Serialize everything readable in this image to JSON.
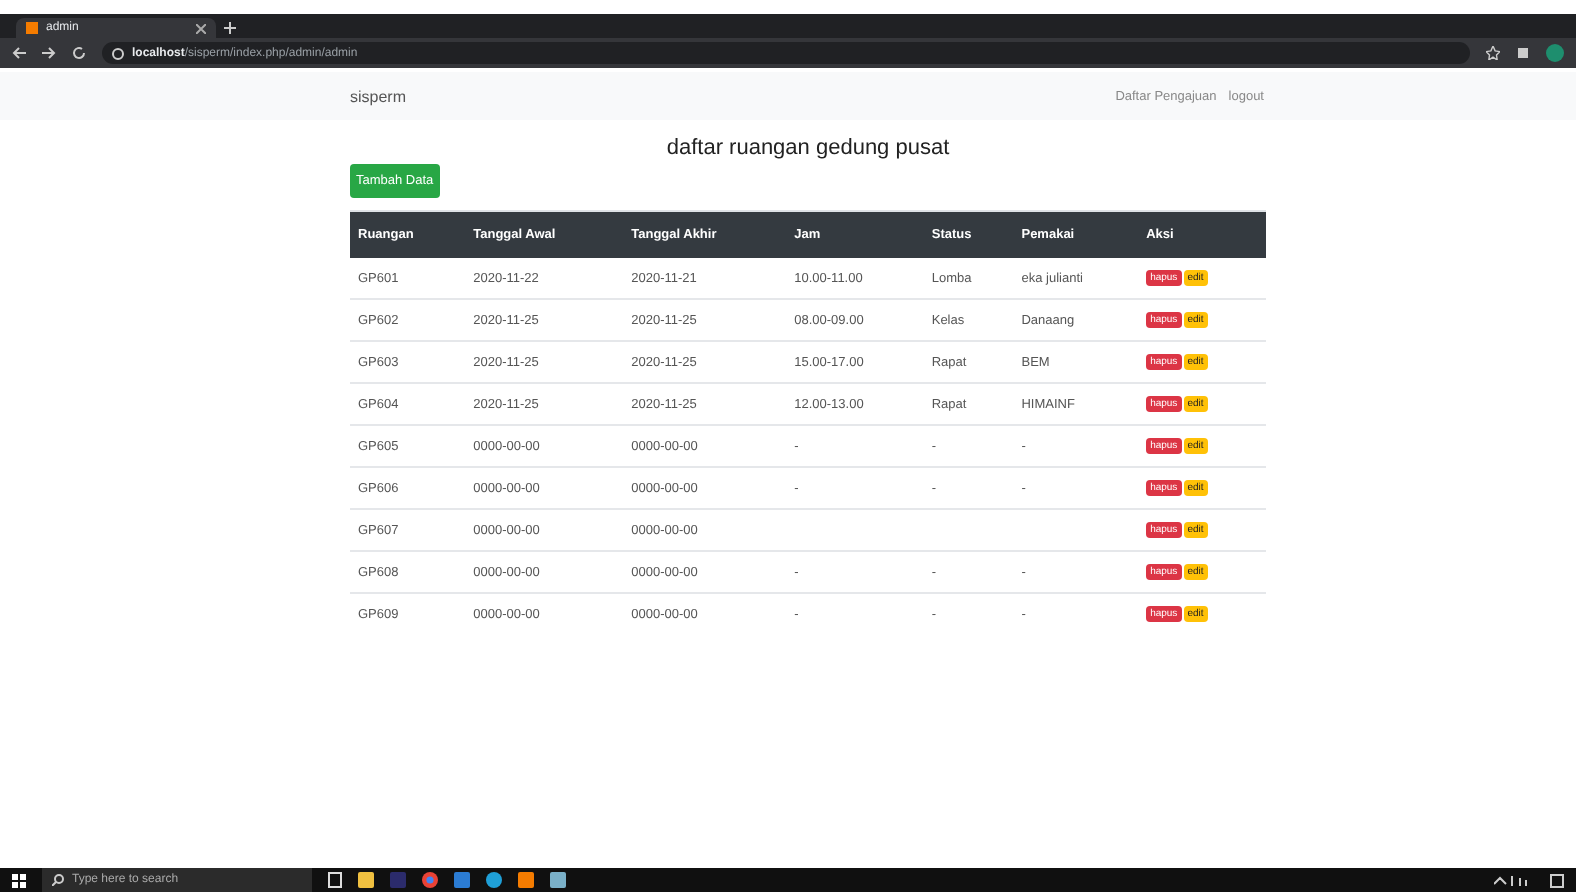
{
  "browser": {
    "tab_title": "admin",
    "url_host": "localhost",
    "url_path": "/sisperm/index.php/admin/admin"
  },
  "navbar": {
    "brand": "sisperm",
    "links": [
      "Daftar Pengajuan",
      "logout"
    ]
  },
  "page": {
    "title": "daftar ruangan gedung pusat",
    "add_button": "Tambah Data"
  },
  "table": {
    "columns": [
      "Ruangan",
      "Tanggal Awal",
      "Tanggal Akhir",
      "Jam",
      "Status",
      "Pemakai",
      "Aksi"
    ],
    "rows": [
      {
        "cells": [
          "GP601",
          "2020-11-22",
          "2020-11-21",
          "10.00-11.00",
          "Lomba",
          "eka julianti"
        ],
        "actions": [
          "hapus",
          "edit"
        ]
      },
      {
        "cells": [
          "GP602",
          "2020-11-25",
          "2020-11-25",
          "08.00-09.00",
          "Kelas",
          "Danaang"
        ],
        "actions": [
          "hapus",
          "edit"
        ]
      },
      {
        "cells": [
          "GP603",
          "2020-11-25",
          "2020-11-25",
          "15.00-17.00",
          "Rapat",
          "BEM"
        ],
        "actions": [
          "hapus",
          "edit"
        ]
      },
      {
        "cells": [
          "GP604",
          "2020-11-25",
          "2020-11-25",
          "12.00-13.00",
          "Rapat",
          "HIMAINF"
        ],
        "actions": [
          "hapus",
          "edit"
        ]
      },
      {
        "cells": [
          "GP605",
          "0000-00-00",
          "0000-00-00",
          "-",
          "-",
          "-"
        ],
        "actions": [
          "hapus",
          "edit"
        ]
      },
      {
        "cells": [
          "GP606",
          "0000-00-00",
          "0000-00-00",
          "-",
          "-",
          "-"
        ],
        "actions": [
          "hapus",
          "edit"
        ]
      },
      {
        "cells": [
          "GP607",
          "0000-00-00",
          "0000-00-00",
          "",
          "",
          ""
        ],
        "actions": [
          "hapus",
          "edit"
        ]
      },
      {
        "cells": [
          "GP608",
          "0000-00-00",
          "0000-00-00",
          "-",
          "-",
          "-"
        ],
        "actions": [
          "hapus",
          "edit"
        ]
      },
      {
        "cells": [
          "GP609",
          "0000-00-00",
          "0000-00-00",
          "-",
          "-",
          "-"
        ],
        "actions": [
          "hapus",
          "edit"
        ]
      }
    ]
  },
  "taskbar": {
    "search_placeholder": "Type here to search"
  }
}
